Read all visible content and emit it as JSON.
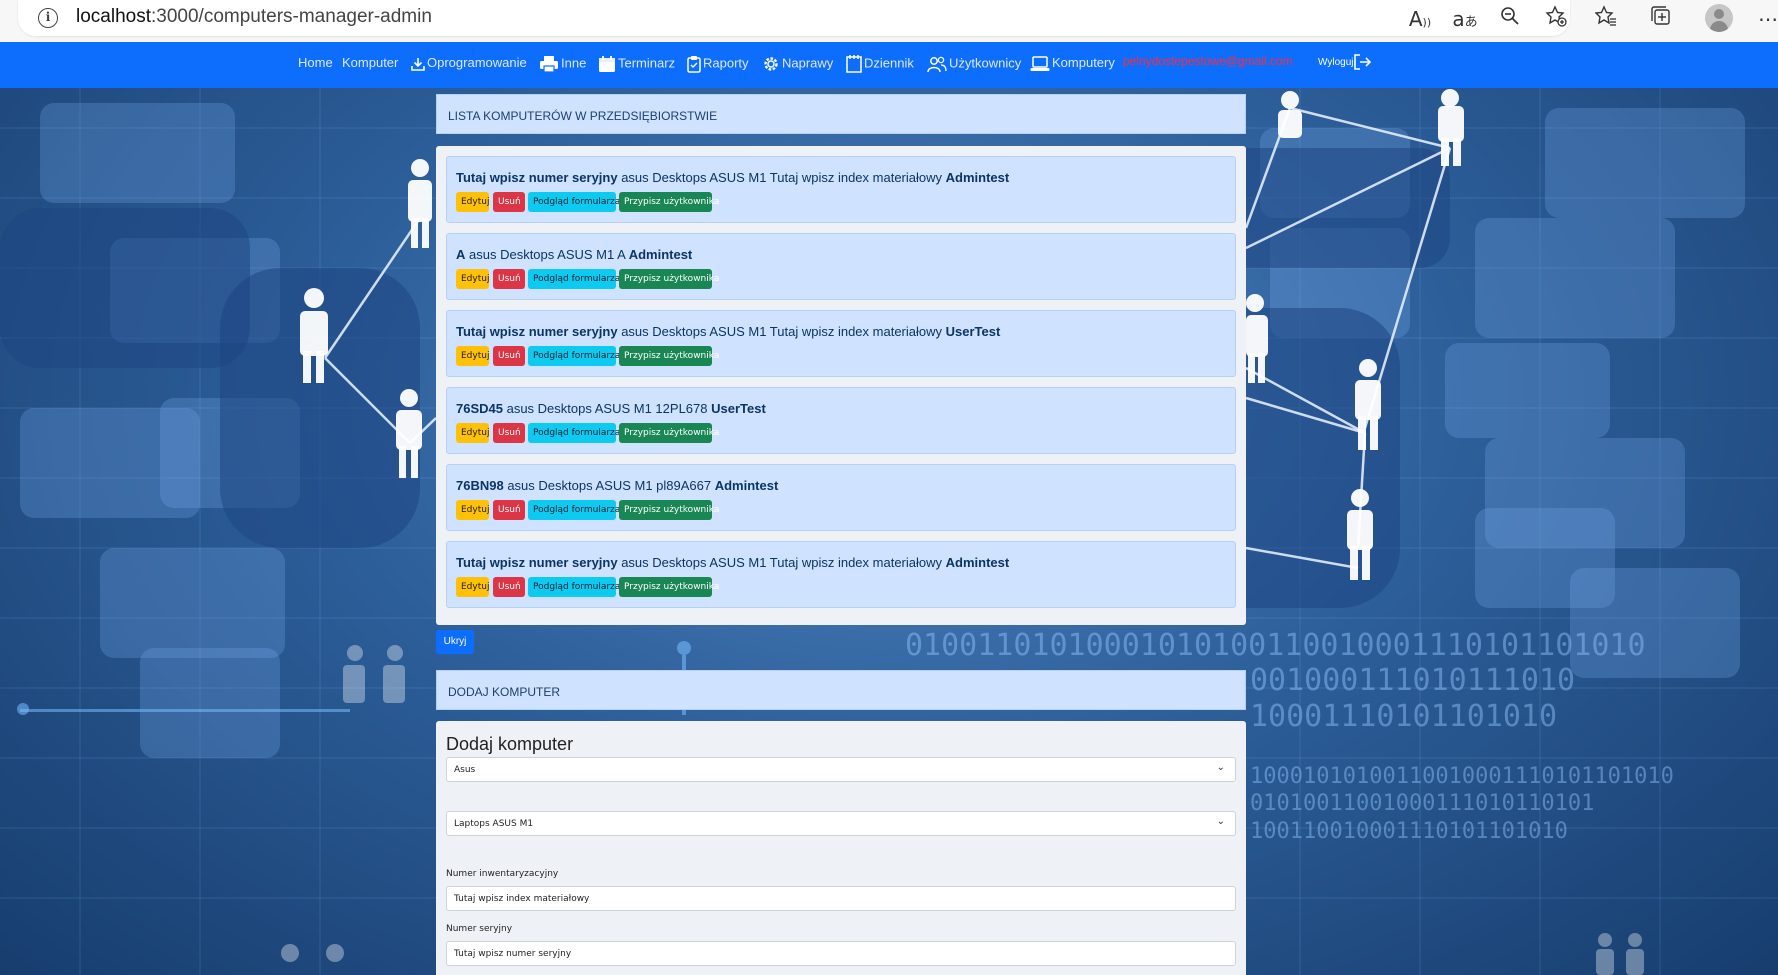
{
  "browser": {
    "url_host": "localhost",
    "url_path": ":3000/computers-manager-admin"
  },
  "navbar": {
    "links": [
      {
        "label": "Home",
        "icon": "none"
      },
      {
        "label": "Komputer",
        "icon": "none"
      },
      {
        "label": "Oprogramowanie",
        "icon": "download-icon"
      },
      {
        "label": "Inne",
        "icon": "printer-icon"
      },
      {
        "label": "Terminarz",
        "icon": "calendar-icon"
      },
      {
        "label": "Raporty",
        "icon": "clipboard-icon"
      },
      {
        "label": "Naprawy",
        "icon": "gear-icon"
      },
      {
        "label": "Dziennik",
        "icon": "journal-icon"
      },
      {
        "label": "Użytkownicy",
        "icon": "users-icon"
      },
      {
        "label": "Komputery",
        "icon": "laptop-icon"
      }
    ],
    "email": "pelnydostepestowe@gmail.com",
    "logout_label": "Wyloguj"
  },
  "colors": {
    "navbar": "#0d6efd",
    "edit": "#ffc107",
    "delete": "#dc3545",
    "view": "#0dcaf0",
    "assign": "#198754",
    "email": "#ff2a3c"
  },
  "list_section": {
    "title": "LISTA KOMPUTERÓW W PRZEDSIĘBIORSTWIE",
    "buttons": {
      "edit": "Edytuj",
      "delete": "Usuń",
      "view": "Podgląd formularza",
      "assign": "Przypisz użytkownika"
    },
    "items": [
      {
        "serial": "Tutaj wpisz numer seryjny",
        "desc": " asus Desktops ASUS M1 Tutaj wpisz index materiałowy ",
        "user": "Admintest"
      },
      {
        "serial": "A",
        "desc": " asus Desktops ASUS M1 A ",
        "user": "Admintest"
      },
      {
        "serial": "Tutaj wpisz numer seryjny",
        "desc": " asus Desktops ASUS M1 Tutaj wpisz index materiałowy ",
        "user": "UserTest"
      },
      {
        "serial": "76SD45",
        "desc": " asus Desktops ASUS M1 12PL678 ",
        "user": "UserTest"
      },
      {
        "serial": "76BN98",
        "desc": " asus Desktops ASUS M1 pl89A667 ",
        "user": "Admintest"
      },
      {
        "serial": "Tutaj wpisz numer seryjny",
        "desc": " asus Desktops ASUS M1 Tutaj wpisz index materiałowy ",
        "user": "Admintest"
      }
    ],
    "hide_label": "Ukryj"
  },
  "add_section": {
    "title": "DODAJ KOMPUTER",
    "form_title": "Dodaj komputer",
    "brand_select": "Asus",
    "model_select": "Laptops ASUS M1",
    "inventory_label": "Numer inwentaryzacyjny",
    "inventory_value": "Tutaj wpisz index materiałowy",
    "serial_label": "Numer seryjny",
    "serial_value": "Tutaj wpisz numer seryjny"
  }
}
